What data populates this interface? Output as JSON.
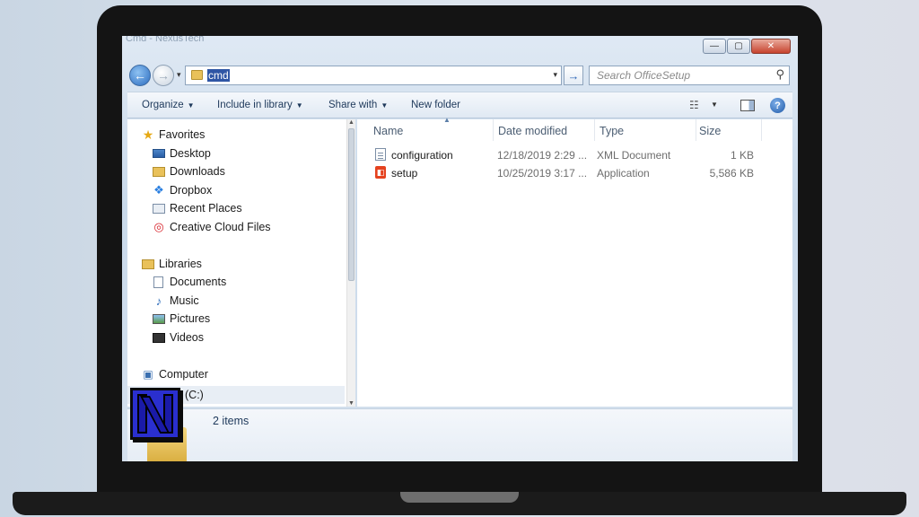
{
  "window": {
    "ghost_title": "Cmd - NexusTech",
    "controls": {
      "minimize": "—",
      "maximize": "▢",
      "close": "✕"
    }
  },
  "address_bar": {
    "path": "cmd",
    "go_symbol": "→"
  },
  "search": {
    "placeholder": "Search OfficeSetup"
  },
  "toolbar": {
    "organize": "Organize",
    "include_in_library": "Include in library",
    "share_with": "Share with",
    "new_folder": "New folder",
    "help": "?"
  },
  "nav_pane": {
    "favorites": {
      "label": "Favorites",
      "items": [
        {
          "label": "Desktop",
          "icon": "desktop-icon"
        },
        {
          "label": "Downloads",
          "icon": "downloads-icon"
        },
        {
          "label": "Dropbox",
          "icon": "dropbox-icon"
        },
        {
          "label": "Recent Places",
          "icon": "recent-places-icon"
        },
        {
          "label": "Creative Cloud Files",
          "icon": "creative-cloud-icon"
        }
      ]
    },
    "libraries": {
      "label": "Libraries",
      "items": [
        {
          "label": "Documents",
          "icon": "documents-icon"
        },
        {
          "label": "Music",
          "icon": "music-icon"
        },
        {
          "label": "Pictures",
          "icon": "pictures-icon"
        },
        {
          "label": "Videos",
          "icon": "videos-icon"
        }
      ]
    },
    "computer": {
      "label": "Computer",
      "drive": "(C:)"
    }
  },
  "file_list": {
    "columns": [
      "Name",
      "Date modified",
      "Type",
      "Size"
    ],
    "rows": [
      {
        "name": "configuration",
        "date": "12/18/2019 2:29 ...",
        "type": "XML Document",
        "size": "1 KB",
        "icon": "xml-document-icon"
      },
      {
        "name": "setup",
        "date": "10/25/2019 3:17 ...",
        "type": "Application",
        "size": "5,586 KB",
        "icon": "office-setup-icon"
      }
    ]
  },
  "details": {
    "count": "2 items"
  },
  "logo": {
    "letter": "N"
  },
  "colors": {
    "selection": "#2f56a5",
    "logo_blue": "#2a2fcf",
    "laptop": "#141414"
  }
}
